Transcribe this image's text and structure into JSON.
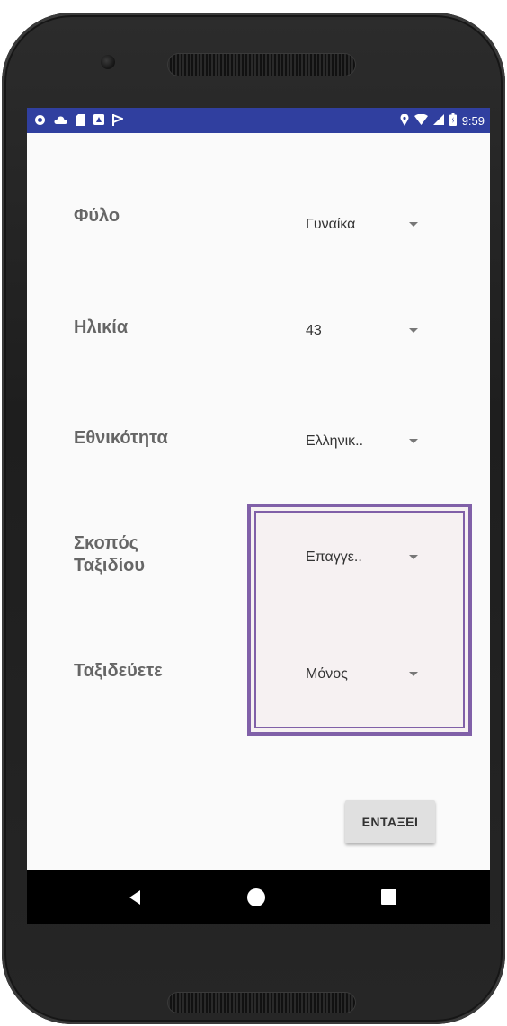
{
  "statusbar": {
    "left_icons": [
      "shield-icon",
      "cloud-icon",
      "sd-card-icon",
      "notification-icon",
      "flag-icon"
    ],
    "right_icons": [
      "location-icon",
      "wifi-icon",
      "signal-icon",
      "battery-icon"
    ],
    "time": "9:59",
    "color": "#303f9f"
  },
  "form": {
    "gender_label": "Φύλο",
    "gender_value": "Γυναίκα",
    "age_label": "Ηλικία",
    "age_value": "43",
    "nationality_label": "Εθνικότητα",
    "nationality_value": "Ελληνικ..",
    "purpose_label_line1": "Σκοπός",
    "purpose_label_line2": "Ταξιδίου",
    "purpose_value": "Επαγγε..",
    "travel_label": "Ταξιδεύετε",
    "travel_value": "Μόνος"
  },
  "ok_button_label": "ΕΝΤΑΞΕΙ",
  "highlight_color": "#8060a8",
  "navbar": {
    "icons": [
      "back-icon",
      "home-icon",
      "recents-icon"
    ]
  }
}
